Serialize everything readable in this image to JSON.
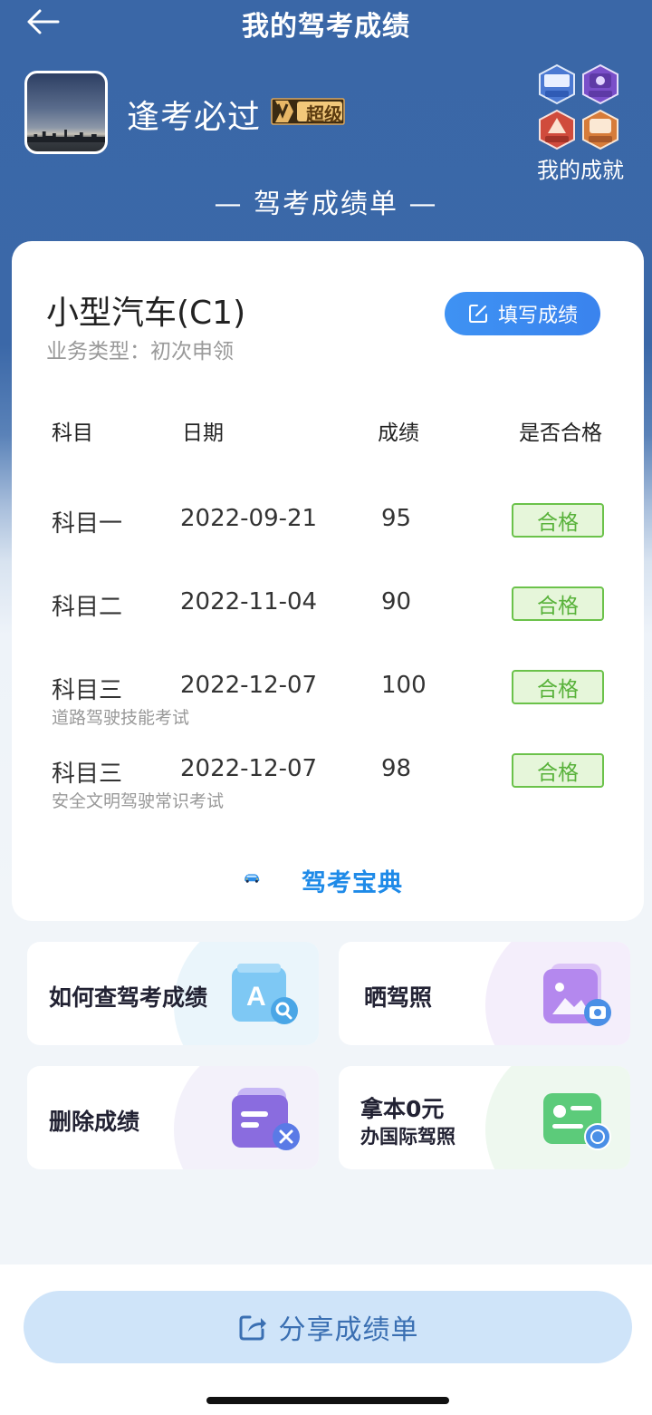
{
  "header": {
    "title": "我的驾考成绩"
  },
  "profile": {
    "username": "逢考必过",
    "vip_label": "超级"
  },
  "achievements": {
    "label": "我的成就"
  },
  "report_title": "— 驾考成绩单 —",
  "card": {
    "vehicle": "小型汽车(C1)",
    "business_type": "业务类型：初次申领",
    "fill_button": "填写成绩",
    "columns": [
      "科目",
      "日期",
      "成绩",
      "是否合格"
    ],
    "rows": [
      {
        "subject": "科目一",
        "date": "2022-09-21",
        "score": "95",
        "result": "合格",
        "note": ""
      },
      {
        "subject": "科目二",
        "date": "2022-11-04",
        "score": "90",
        "result": "合格",
        "note": ""
      },
      {
        "subject": "科目三",
        "date": "2022-12-07",
        "score": "100",
        "result": "合格",
        "note": "道路驾驶技能考试"
      },
      {
        "subject": "科目三",
        "date": "2022-12-07",
        "score": "98",
        "result": "合格",
        "note": "安全文明驾驶常识考试"
      }
    ],
    "brand": "驾考宝典"
  },
  "tiles": {
    "how_to": "如何查驾考成绩",
    "show_license": "晒驾照",
    "delete": "删除成绩",
    "intl_line1": "拿本0元",
    "intl_line2": "办国际驾照"
  },
  "share_button": "分享成绩单",
  "colors": {
    "header_blue": "#3a67a7",
    "accent_blue": "#3a83ee",
    "pass_green": "#58b23a"
  }
}
